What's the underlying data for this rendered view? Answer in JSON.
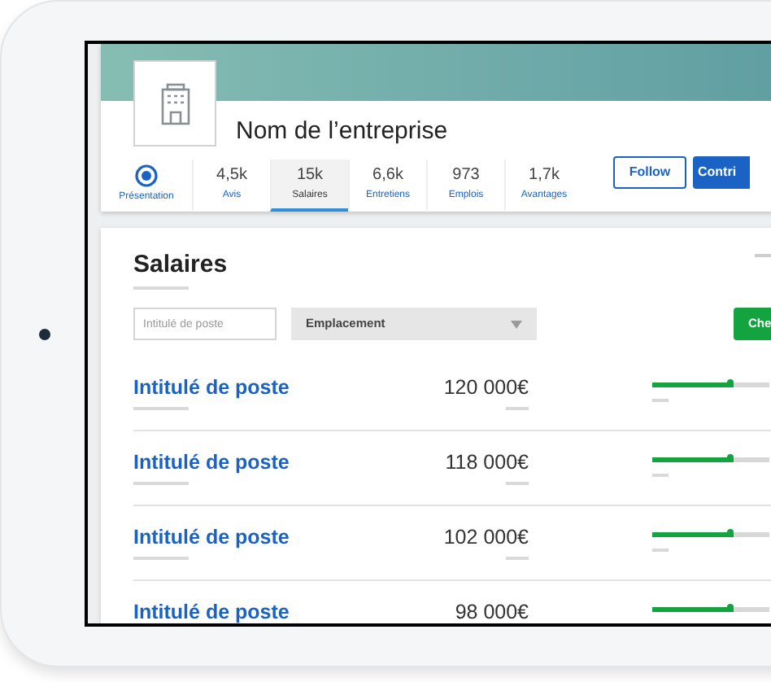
{
  "header": {
    "company_name": "Nom de l’entreprise",
    "tabs": [
      {
        "kind": "icon",
        "label": "Présentation",
        "selected": false
      },
      {
        "kind": "count",
        "count": "4,5k",
        "label": "Avis",
        "selected": false
      },
      {
        "kind": "count",
        "count": "15k",
        "label": "Salaires",
        "selected": true
      },
      {
        "kind": "count",
        "count": "6,6k",
        "label": "Entretiens",
        "selected": false
      },
      {
        "kind": "count",
        "count": "973",
        "label": "Emplois",
        "selected": false
      },
      {
        "kind": "count",
        "count": "1,7k",
        "label": "Avantages",
        "selected": false
      }
    ],
    "follow_button": "Follow",
    "contribute_button": "Contri"
  },
  "salaries": {
    "title": "Salaires",
    "job_field": {
      "placeholder": "Intitulé de poste"
    },
    "location_select": {
      "value": "Emplacement"
    },
    "search_button": "Che",
    "rows": [
      {
        "job_title": "Intitulé de poste",
        "amount": "120 000€",
        "level": 0.67
      },
      {
        "job_title": "Intitulé de poste",
        "amount": "118 000€",
        "level": 0.67
      },
      {
        "job_title": "Intitulé de poste",
        "amount": "102 000€",
        "level": 0.67
      },
      {
        "job_title": "Intitulé de poste",
        "amount": "98 000€",
        "level": 0.67
      }
    ]
  }
}
